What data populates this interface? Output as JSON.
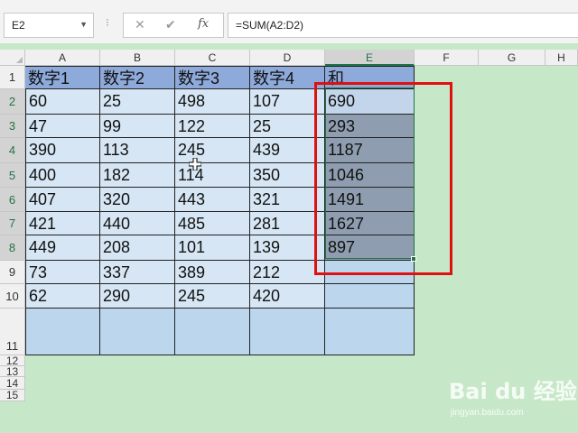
{
  "name_box": {
    "value": "E2"
  },
  "formula_bar": {
    "cancel_glyph": "✕",
    "enter_glyph": "✔",
    "fx_label": "fx",
    "formula": "=SUM(A2:D2)"
  },
  "columns": [
    "A",
    "B",
    "C",
    "D",
    "E",
    "F",
    "G",
    "H"
  ],
  "rows": [
    "1",
    "2",
    "3",
    "4",
    "5",
    "6",
    "7",
    "8",
    "9",
    "10",
    "11",
    "12",
    "13",
    "14",
    "15"
  ],
  "table": {
    "headers": [
      "数字1",
      "数字2",
      "数字3",
      "数字4",
      "和"
    ],
    "data": [
      [
        "60",
        "25",
        "498",
        "107",
        "690"
      ],
      [
        "47",
        "99",
        "122",
        "25",
        "293"
      ],
      [
        "390",
        "113",
        "245",
        "439",
        "1187"
      ],
      [
        "400",
        "182",
        "114",
        "350",
        "1046"
      ],
      [
        "407",
        "320",
        "443",
        "321",
        "1491"
      ],
      [
        "421",
        "440",
        "485",
        "281",
        "1627"
      ],
      [
        "449",
        "208",
        "101",
        "139",
        "897"
      ],
      [
        "73",
        "337",
        "389",
        "212",
        ""
      ],
      [
        "62",
        "290",
        "245",
        "420",
        ""
      ]
    ]
  },
  "selection": {
    "active_cell": "E2",
    "range": "E2:E8"
  },
  "colors": {
    "header_fill": "#8eaadb",
    "cell_fill": "#d6e6f4",
    "selected_fill": "#8e9eb0",
    "sheet_bg": "#c6e8c8",
    "highlight_red": "#e01010",
    "excel_green": "#217346"
  },
  "watermark": {
    "brand": "Bai du 经验",
    "url": "jingyan.baidu.com"
  }
}
